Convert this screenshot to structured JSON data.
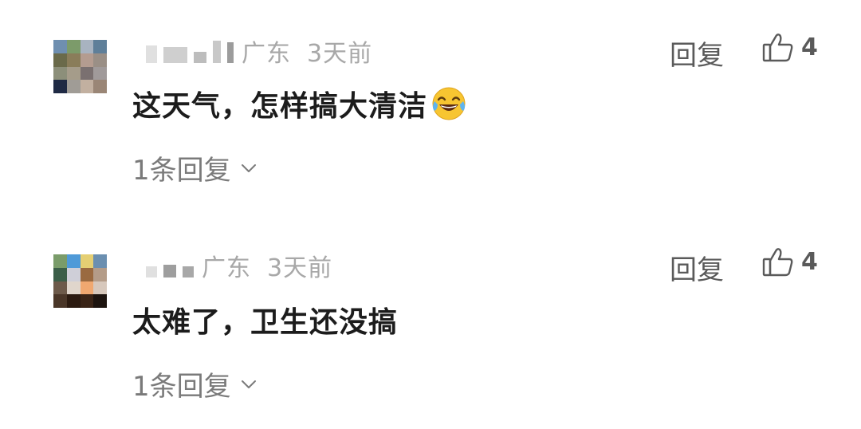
{
  "comments": [
    {
      "location": "广东",
      "time": "3天前",
      "text": "这天气，怎样搞大清洁",
      "emoji": "tears-of-joy-emoji",
      "replies_label": "1条回复",
      "reply_label": "回复",
      "likes": "4"
    },
    {
      "location": "广东",
      "time": "3天前",
      "text": "太难了，卫生还没搞",
      "replies_label": "1条回复",
      "reply_label": "回复",
      "likes": "4"
    }
  ],
  "icons": {
    "like": "thumbs-up-icon",
    "expand": "chevron-down-icon"
  },
  "colors": {
    "meta": "#a8a8a8",
    "body": "#1c1c1c",
    "secondary": "#7a7a7a",
    "action": "#5a5a5a"
  }
}
